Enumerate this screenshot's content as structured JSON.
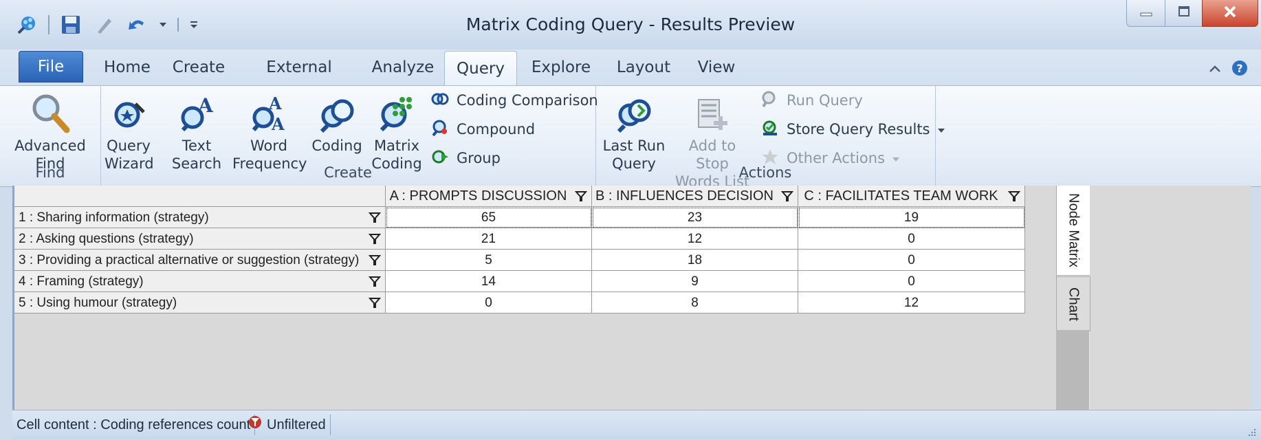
{
  "window": {
    "title": "Matrix Coding Query - Results Preview",
    "buttons": [
      "minimize-icon",
      "maximize-icon",
      "close-icon"
    ]
  },
  "quick_access": [
    "nvivo-logo-icon",
    "save-icon",
    "edit-icon",
    "undo-icon",
    "dropdown-icon",
    "customize-icon"
  ],
  "tabs": [
    {
      "label": "File"
    },
    {
      "label": "Home"
    },
    {
      "label": "Create"
    },
    {
      "label": "External Data"
    },
    {
      "label": "Analyze"
    },
    {
      "label": "Query"
    },
    {
      "label": "Explore"
    },
    {
      "label": "Layout"
    },
    {
      "label": "View"
    }
  ],
  "active_tab": "Query",
  "ribbon": {
    "find": {
      "group_label": "Find",
      "advanced_find": {
        "line1": "Advanced",
        "line2": "Find"
      }
    },
    "create": {
      "group_label": "Create",
      "query_wizard": {
        "line1": "Query",
        "line2": "Wizard"
      },
      "text_search": {
        "line1": "Text",
        "line2": "Search"
      },
      "word_frequency": {
        "line1": "Word",
        "line2": "Frequency"
      },
      "coding": {
        "line1": "Coding"
      },
      "matrix_coding": {
        "line1": "Matrix",
        "line2": "Coding"
      },
      "coding_comparison": "Coding Comparison",
      "compound": "Compound",
      "group": "Group"
    },
    "actions": {
      "group_label": "Actions",
      "last_run_query": {
        "line1": "Last Run",
        "line2": "Query"
      },
      "add_to_stop_words": {
        "line1": "Add to Stop",
        "line2": "Words List"
      },
      "run_query": "Run Query",
      "store_query_results": "Store Query Results",
      "other_actions": "Other Actions"
    }
  },
  "matrix": {
    "columns": [
      "A : PROMPTS DISCUSSION",
      "B : INFLUENCES DECISION",
      "C : FACILITATES TEAM WORK"
    ],
    "rows": [
      {
        "label": "1 : Sharing information (strategy)",
        "values": [
          "65",
          "23",
          "19"
        ]
      },
      {
        "label": "2 : Asking questions (strategy)",
        "values": [
          "21",
          "12",
          "0"
        ]
      },
      {
        "label": "3 : Providing a practical alternative or suggestion (strategy)",
        "values": [
          "5",
          "18",
          "0"
        ]
      },
      {
        "label": "4 : Framing (strategy)",
        "values": [
          "14",
          "9",
          "0"
        ]
      },
      {
        "label": "5 : Using humour (strategy)",
        "values": [
          "0",
          "8",
          "12"
        ]
      }
    ]
  },
  "side_tabs": [
    "Node Matrix",
    "Chart"
  ],
  "status": {
    "cell_content": "Cell content : Coding references count",
    "filter": "Unfiltered"
  },
  "colors": {
    "accent": "#2a63b5",
    "ribbon_bg": "#e6eef8",
    "grid_header": "#efefef"
  }
}
